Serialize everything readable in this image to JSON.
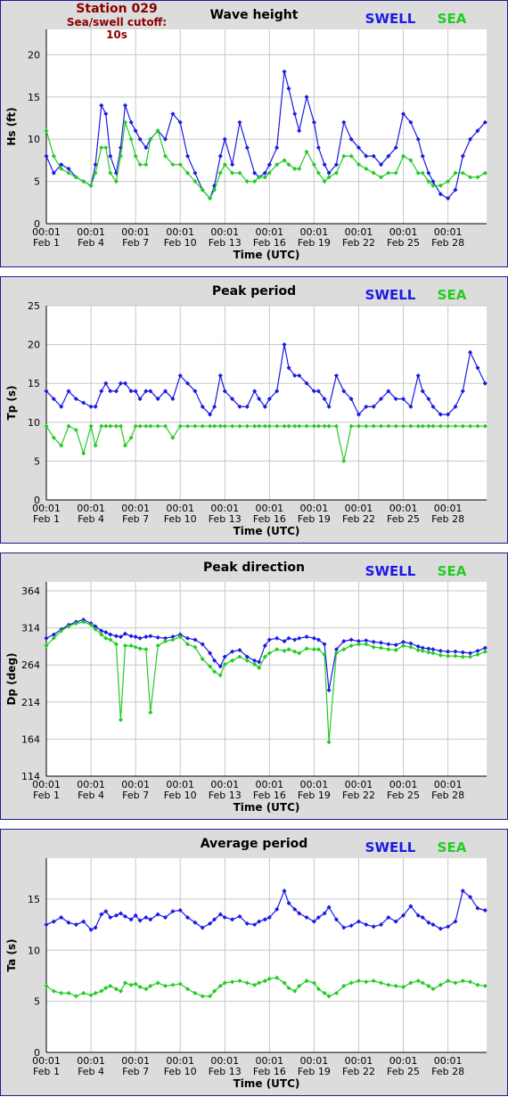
{
  "header": {
    "station": "Station 029",
    "cutoff": "Sea/swell cutoff: 10s"
  },
  "legend": {
    "swell": "SWELL",
    "sea": "SEA",
    "swell_color": "#1a1ae6",
    "sea_color": "#22cc22"
  },
  "x_axis": {
    "label": "Time (UTC)",
    "ticks": [
      {
        "time": "00:01",
        "date": "Feb 1",
        "day": 1
      },
      {
        "time": "00:01",
        "date": "Feb 4",
        "day": 4
      },
      {
        "time": "00:01",
        "date": "Feb 7",
        "day": 7
      },
      {
        "time": "00:01",
        "date": "Feb 10",
        "day": 10
      },
      {
        "time": "00:01",
        "date": "Feb 13",
        "day": 13
      },
      {
        "time": "00:01",
        "date": "Feb 16",
        "day": 16
      },
      {
        "time": "00:01",
        "date": "Feb 19",
        "day": 19
      },
      {
        "time": "00:01",
        "date": "Feb 22",
        "day": 22
      },
      {
        "time": "00:01",
        "date": "Feb 25",
        "day": 25
      },
      {
        "time": "00:01",
        "date": "Feb 28",
        "day": 28
      }
    ],
    "range_days": [
      1,
      30.6
    ]
  },
  "chart_data": [
    {
      "type": "line",
      "title": "Wave height",
      "ylabel": "Hs (ft)",
      "ylim": [
        0,
        23
      ],
      "yticks": [
        0,
        5,
        10,
        15,
        20
      ],
      "x_days": [
        1,
        1.5,
        2,
        2.5,
        3,
        3.5,
        4,
        4.3,
        4.7,
        5,
        5.3,
        5.7,
        6,
        6.3,
        6.7,
        7,
        7.3,
        7.7,
        8,
        8.5,
        9,
        9.5,
        10,
        10.5,
        11,
        11.5,
        12,
        12.3,
        12.7,
        13,
        13.5,
        14,
        14.5,
        15,
        15.3,
        15.7,
        16,
        16.5,
        17,
        17.3,
        17.7,
        18,
        18.5,
        19,
        19.3,
        19.7,
        20,
        20.5,
        21,
        21.5,
        22,
        22.5,
        23,
        23.5,
        24,
        24.5,
        25,
        25.5,
        26,
        26.3,
        26.7,
        27,
        27.5,
        28,
        28.5,
        29,
        29.5,
        30,
        30.5
      ],
      "series": [
        {
          "name": "SWELL",
          "values": [
            8,
            6,
            7,
            6.5,
            5.5,
            5,
            4.5,
            7,
            14,
            13,
            8,
            6,
            9,
            14,
            12,
            11,
            10,
            9,
            10,
            11,
            10,
            13,
            12,
            8,
            6,
            4,
            3,
            4.5,
            8,
            10,
            7,
            12,
            9,
            6,
            5.5,
            6,
            7,
            9,
            18,
            16,
            13,
            11,
            15,
            12,
            9,
            7,
            6,
            7,
            12,
            10,
            9,
            8,
            8,
            7,
            8,
            9,
            13,
            12,
            10,
            8,
            6,
            5,
            3.5,
            3,
            4,
            8,
            10,
            11,
            12
          ]
        },
        {
          "name": "SEA",
          "values": [
            11,
            8,
            6.5,
            6,
            5.5,
            5,
            4.5,
            6,
            9,
            9,
            6,
            5,
            8,
            12,
            10,
            8,
            7,
            7,
            10,
            11,
            8,
            7,
            7,
            6,
            5,
            4,
            3,
            4,
            6,
            7,
            6,
            6,
            5,
            5,
            5.5,
            5.5,
            6,
            7,
            7.5,
            7,
            6.5,
            6.5,
            8.5,
            7,
            6,
            5,
            5.5,
            6,
            8,
            8,
            7,
            6.5,
            6,
            5.5,
            6,
            6,
            8,
            7.5,
            6,
            6,
            5,
            4.5,
            4.5,
            5,
            6,
            6,
            5.5,
            5.5,
            6
          ]
        }
      ]
    },
    {
      "type": "line",
      "title": "Peak period",
      "ylabel": "Tp (s)",
      "ylim": [
        0,
        25
      ],
      "yticks": [
        0,
        5,
        10,
        15,
        20,
        25
      ],
      "x_days": [
        1,
        1.5,
        2,
        2.5,
        3,
        3.5,
        4,
        4.3,
        4.7,
        5,
        5.3,
        5.7,
        6,
        6.3,
        6.7,
        7,
        7.3,
        7.7,
        8,
        8.5,
        9,
        9.5,
        10,
        10.5,
        11,
        11.5,
        12,
        12.3,
        12.7,
        13,
        13.5,
        14,
        14.5,
        15,
        15.3,
        15.7,
        16,
        16.5,
        17,
        17.3,
        17.7,
        18,
        18.5,
        19,
        19.3,
        19.7,
        20,
        20.5,
        21,
        21.5,
        22,
        22.5,
        23,
        23.5,
        24,
        24.5,
        25,
        25.5,
        26,
        26.3,
        26.7,
        27,
        27.5,
        28,
        28.5,
        29,
        29.5,
        30,
        30.5
      ],
      "series": [
        {
          "name": "SWELL",
          "values": [
            14,
            13,
            12,
            14,
            13,
            12.5,
            12,
            12,
            14,
            15,
            14,
            14,
            15,
            15,
            14,
            14,
            13,
            14,
            14,
            13,
            14,
            13,
            16,
            15,
            14,
            12,
            11,
            12,
            16,
            14,
            13,
            12,
            12,
            14,
            13,
            12,
            13,
            14,
            20,
            17,
            16,
            16,
            15,
            14,
            14,
            13,
            12,
            16,
            14,
            13,
            11,
            12,
            12,
            13,
            14,
            13,
            13,
            12,
            16,
            14,
            13,
            12,
            11,
            11,
            12,
            14,
            19,
            17,
            15
          ]
        },
        {
          "name": "SEA",
          "values": [
            9.5,
            8,
            7,
            9.5,
            9,
            6,
            9.5,
            7,
            9.5,
            9.5,
            9.5,
            9.5,
            9.5,
            7,
            8,
            9.5,
            9.5,
            9.5,
            9.5,
            9.5,
            9.5,
            8,
            9.5,
            9.5,
            9.5,
            9.5,
            9.5,
            9.5,
            9.5,
            9.5,
            9.5,
            9.5,
            9.5,
            9.5,
            9.5,
            9.5,
            9.5,
            9.5,
            9.5,
            9.5,
            9.5,
            9.5,
            9.5,
            9.5,
            9.5,
            9.5,
            9.5,
            9.5,
            5,
            9.5,
            9.5,
            9.5,
            9.5,
            9.5,
            9.5,
            9.5,
            9.5,
            9.5,
            9.5,
            9.5,
            9.5,
            9.5,
            9.5,
            9.5,
            9.5,
            9.5,
            9.5,
            9.5,
            9.5
          ]
        }
      ]
    },
    {
      "type": "line",
      "title": "Peak direction",
      "ylabel": "Dp (deg)",
      "ylim": [
        114,
        376
      ],
      "yticks": [
        114,
        164,
        214,
        264,
        314,
        364
      ],
      "x_days": [
        1,
        1.5,
        2,
        2.5,
        3,
        3.5,
        4,
        4.3,
        4.7,
        5,
        5.3,
        5.7,
        6,
        6.3,
        6.7,
        7,
        7.3,
        7.7,
        8,
        8.5,
        9,
        9.5,
        10,
        10.5,
        11,
        11.5,
        12,
        12.3,
        12.7,
        13,
        13.5,
        14,
        14.5,
        15,
        15.3,
        15.7,
        16,
        16.5,
        17,
        17.3,
        17.7,
        18,
        18.5,
        19,
        19.3,
        19.7,
        20,
        20.5,
        21,
        21.5,
        22,
        22.5,
        23,
        23.5,
        24,
        24.5,
        25,
        25.5,
        26,
        26.3,
        26.7,
        27,
        27.5,
        28,
        28.5,
        29,
        29.5,
        30,
        30.5
      ],
      "series": [
        {
          "name": "SWELL",
          "values": [
            300,
            305,
            312,
            318,
            322,
            325,
            320,
            316,
            310,
            308,
            305,
            303,
            302,
            306,
            303,
            302,
            300,
            302,
            303,
            301,
            300,
            302,
            305,
            300,
            298,
            292,
            280,
            270,
            262,
            275,
            282,
            284,
            275,
            270,
            268,
            290,
            298,
            300,
            296,
            300,
            298,
            300,
            302,
            300,
            298,
            292,
            230,
            285,
            296,
            298,
            296,
            297,
            295,
            294,
            292,
            291,
            295,
            293,
            289,
            287,
            286,
            285,
            283,
            282,
            282,
            281,
            280,
            283,
            287
          ]
        },
        {
          "name": "SEA",
          "values": [
            290,
            300,
            310,
            316,
            320,
            322,
            318,
            312,
            305,
            300,
            298,
            292,
            190,
            290,
            290,
            288,
            286,
            285,
            200,
            290,
            296,
            298,
            302,
            292,
            288,
            272,
            262,
            255,
            250,
            265,
            270,
            275,
            270,
            265,
            260,
            275,
            280,
            285,
            283,
            285,
            282,
            280,
            286,
            285,
            285,
            278,
            160,
            280,
            285,
            290,
            292,
            292,
            288,
            287,
            285,
            284,
            290,
            288,
            284,
            283,
            281,
            280,
            277,
            276,
            276,
            275,
            275,
            278,
            282
          ]
        }
      ]
    },
    {
      "type": "line",
      "title": "Average period",
      "ylabel": "Ta (s)",
      "ylim": [
        0,
        19
      ],
      "yticks": [
        0,
        5,
        10,
        15
      ],
      "x_days": [
        1,
        1.5,
        2,
        2.5,
        3,
        3.5,
        4,
        4.3,
        4.7,
        5,
        5.3,
        5.7,
        6,
        6.3,
        6.7,
        7,
        7.3,
        7.7,
        8,
        8.5,
        9,
        9.5,
        10,
        10.5,
        11,
        11.5,
        12,
        12.3,
        12.7,
        13,
        13.5,
        14,
        14.5,
        15,
        15.3,
        15.7,
        16,
        16.5,
        17,
        17.3,
        17.7,
        18,
        18.5,
        19,
        19.3,
        19.7,
        20,
        20.5,
        21,
        21.5,
        22,
        22.5,
        23,
        23.5,
        24,
        24.5,
        25,
        25.5,
        26,
        26.3,
        26.7,
        27,
        27.5,
        28,
        28.5,
        29,
        29.5,
        30,
        30.5
      ],
      "series": [
        {
          "name": "SWELL",
          "values": [
            12.5,
            12.8,
            13.2,
            12.7,
            12.5,
            12.8,
            12,
            12.2,
            13.5,
            13.8,
            13.2,
            13.4,
            13.6,
            13.3,
            13,
            13.4,
            12.9,
            13.2,
            13,
            13.5,
            13.2,
            13.8,
            13.9,
            13.2,
            12.7,
            12.2,
            12.6,
            13,
            13.5,
            13.2,
            13,
            13.3,
            12.6,
            12.5,
            12.8,
            13,
            13.2,
            14,
            15.8,
            14.6,
            14,
            13.6,
            13.2,
            12.8,
            13.2,
            13.6,
            14.2,
            13,
            12.2,
            12.4,
            12.8,
            12.5,
            12.3,
            12.5,
            13.2,
            12.8,
            13.4,
            14.3,
            13.4,
            13.2,
            12.7,
            12.5,
            12.1,
            12.3,
            12.8,
            15.8,
            15.2,
            14.1,
            13.9
          ]
        },
        {
          "name": "SEA",
          "values": [
            6.5,
            6.0,
            5.8,
            5.8,
            5.5,
            5.8,
            5.6,
            5.8,
            6,
            6.3,
            6.5,
            6.2,
            6,
            6.8,
            6.6,
            6.7,
            6.4,
            6.2,
            6.5,
            6.8,
            6.5,
            6.6,
            6.7,
            6.2,
            5.8,
            5.5,
            5.5,
            6,
            6.5,
            6.8,
            6.9,
            7,
            6.8,
            6.6,
            6.8,
            7,
            7.2,
            7.3,
            6.8,
            6.3,
            6,
            6.5,
            7,
            6.8,
            6.2,
            5.8,
            5.5,
            5.8,
            6.5,
            6.8,
            7,
            6.9,
            7,
            6.8,
            6.6,
            6.5,
            6.4,
            6.8,
            7,
            6.8,
            6.5,
            6.2,
            6.6,
            7,
            6.8,
            7,
            6.9,
            6.6,
            6.5
          ]
        }
      ]
    }
  ]
}
